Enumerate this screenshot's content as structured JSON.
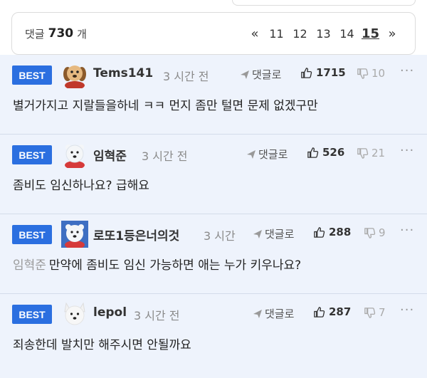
{
  "pagination": {
    "comment_label": "댓글",
    "comment_count": "730",
    "count_unit": "개",
    "prev": "«",
    "pages": [
      "11",
      "12",
      "13",
      "14"
    ],
    "current": "15",
    "next": "»"
  },
  "actions": {
    "reply_label": "댓글로",
    "more": "···"
  },
  "comments": [
    {
      "badge": "BEST",
      "nickname": "Tems141",
      "time": "3 시간 전",
      "likes": "1715",
      "dislikes": "10",
      "mention": "",
      "text": "별거가지고 지랄들을하네 ㅋㅋ 먼지 좀만 털면 문제 없겠구만",
      "avatar": "puppy-avatar"
    },
    {
      "badge": "BEST",
      "nickname": "임혁준",
      "time": "3 시간 전",
      "likes": "526",
      "dislikes": "21",
      "mention": "",
      "text": "좀비도 임신하나요? 급해요",
      "avatar": "polar-bear-avatar"
    },
    {
      "badge": "BEST",
      "nickname": "로또1등은너의것",
      "time": "3 시간",
      "likes": "288",
      "dislikes": "9",
      "mention": "임혁준",
      "text": "만약에 좀비도 임신 가능하면 애는 누가 키우나요?",
      "avatar": "polar-bear-avatar"
    },
    {
      "badge": "BEST",
      "nickname": "lepol",
      "time": "3 시간 전",
      "likes": "287",
      "dislikes": "7",
      "mention": "",
      "text": "죄송한데 발치만 해주시면 안될까요",
      "avatar": "white-dog-avatar"
    }
  ],
  "colors": {
    "best_badge": "#2b6fe0",
    "comment_bg": "#eef3fc"
  }
}
